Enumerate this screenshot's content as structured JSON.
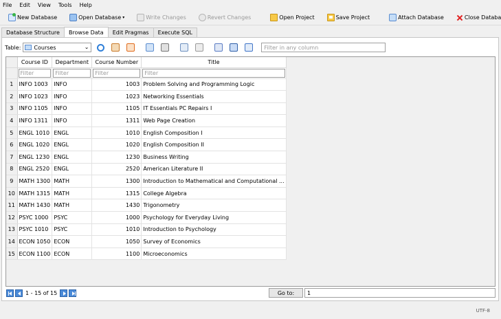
{
  "menu": [
    "File",
    "Edit",
    "View",
    "Tools",
    "Help"
  ],
  "toolbar": {
    "new_database": "New Database",
    "open_database": "Open Database",
    "write_changes": "Write Changes",
    "revert_changes": "Revert Changes",
    "open_project": "Open Project",
    "save_project": "Save Project",
    "attach_database": "Attach Database",
    "close_database": "Close Database"
  },
  "tabs": [
    "Database Structure",
    "Browse Data",
    "Edit Pragmas",
    "Execute SQL"
  ],
  "active_tab": "Browse Data",
  "browse": {
    "table_label": "Table:",
    "table_value": "Courses",
    "filter_all_placeholder": "Filter in any column"
  },
  "grid": {
    "columns": [
      "Course ID",
      "Department",
      "Course Number",
      "Title"
    ],
    "filter_placeholder": "Filter",
    "rows": [
      {
        "n": "1",
        "id": "INFO 1003",
        "dept": "INFO",
        "num": "1003",
        "title": "Problem Solving and Programming Logic"
      },
      {
        "n": "2",
        "id": "INFO 1023",
        "dept": "INFO",
        "num": "1023",
        "title": "Networking Essentials"
      },
      {
        "n": "3",
        "id": "INFO 1105",
        "dept": "INFO",
        "num": "1105",
        "title": "IT Essentials PC Repairs I"
      },
      {
        "n": "4",
        "id": "INFO 1311",
        "dept": "INFO",
        "num": "1311",
        "title": "Web Page Creation"
      },
      {
        "n": "5",
        "id": "ENGL 1010",
        "dept": "ENGL",
        "num": "1010",
        "title": "English Composition I"
      },
      {
        "n": "6",
        "id": "ENGL 1020",
        "dept": "ENGL",
        "num": "1020",
        "title": "English Composition II"
      },
      {
        "n": "7",
        "id": "ENGL 1230",
        "dept": "ENGL",
        "num": "1230",
        "title": "Business Writing"
      },
      {
        "n": "8",
        "id": "ENGL 2520",
        "dept": "ENGL",
        "num": "2520",
        "title": "American Literature II"
      },
      {
        "n": "9",
        "id": "MATH 1300",
        "dept": "MATH",
        "num": "1300",
        "title": "Introduction to Mathematical and Computational ..."
      },
      {
        "n": "10",
        "id": "MATH 1315",
        "dept": "MATH",
        "num": "1315",
        "title": "College Algebra"
      },
      {
        "n": "11",
        "id": "MATH 1430",
        "dept": "MATH",
        "num": "1430",
        "title": "Trigonometry"
      },
      {
        "n": "12",
        "id": "PSYC 1000",
        "dept": "PSYC",
        "num": "1000",
        "title": "Psychology for Everyday Living"
      },
      {
        "n": "13",
        "id": "PSYC 1010",
        "dept": "PSYC",
        "num": "1010",
        "title": "Introduction to Psychology"
      },
      {
        "n": "14",
        "id": "ECON 1050",
        "dept": "ECON",
        "num": "1050",
        "title": "Survey of Economics"
      },
      {
        "n": "15",
        "id": "ECON 1100",
        "dept": "ECON",
        "num": "1100",
        "title": "Microeconomics"
      }
    ]
  },
  "navigation": {
    "range_text": "1 - 15 of 15",
    "goto_label": "Go to:",
    "goto_value": "1"
  },
  "status": {
    "encoding": "UTF-8"
  }
}
